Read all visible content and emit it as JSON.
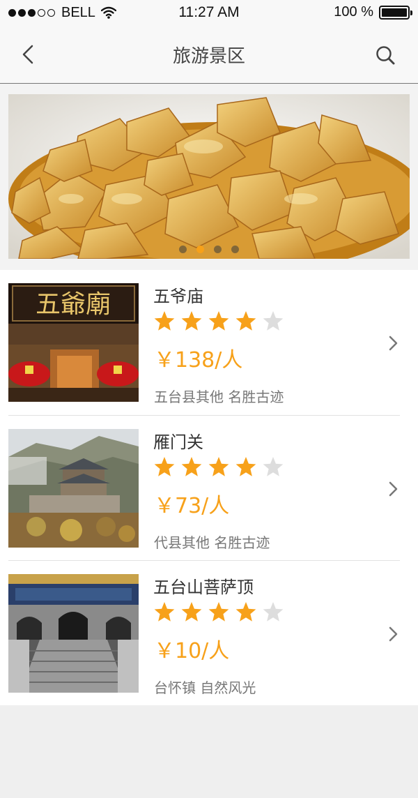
{
  "status_bar": {
    "carrier": "BELL",
    "time": "11:27 AM",
    "battery": "100 %",
    "signal_dots_filled": 3,
    "signal_dots_total": 5
  },
  "nav": {
    "title": "旅游景区",
    "back_icon": "chevron-left-icon",
    "search_icon": "search-icon"
  },
  "banner": {
    "page_count": 4,
    "active_page": 2
  },
  "spots": [
    {
      "name": "五爷庙",
      "rating": 4,
      "max_rating": 5,
      "price": "￥138/人",
      "location": "五台县其他",
      "category": "名胜古迹"
    },
    {
      "name": "雁门关",
      "rating": 4,
      "max_rating": 5,
      "price": "￥73/人",
      "location": "代县其他",
      "category": "名胜古迹"
    },
    {
      "name": "五台山菩萨顶",
      "rating": 4,
      "max_rating": 5,
      "price": "￥10/人",
      "location": "台怀镇",
      "category": "自然风光"
    }
  ],
  "colors": {
    "accent": "#f7a11a",
    "star_empty": "#dddddd",
    "nav_bg": "#f8f8f8",
    "page_bg": "#efefef"
  }
}
